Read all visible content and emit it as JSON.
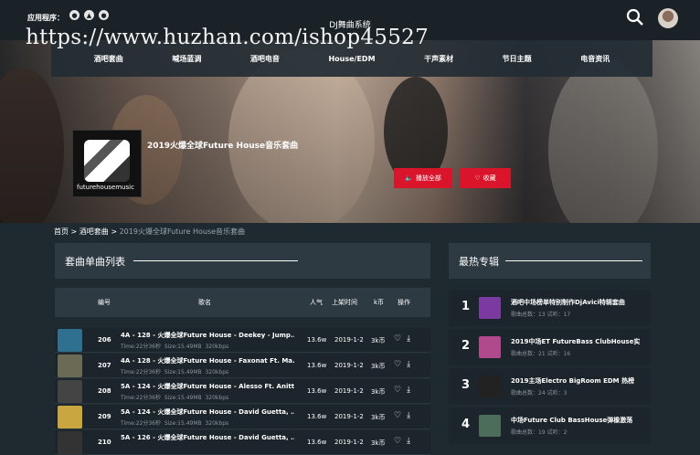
{
  "header": {
    "app_label": "应用程序：",
    "os_icons": [
      "apple-icon",
      "android-icon",
      "apple-icon"
    ],
    "site_title": "DJ舞曲系统",
    "watermark": "https://www.huzhan.com/ishop45527"
  },
  "nav": {
    "items": [
      {
        "label": "酒吧套曲"
      },
      {
        "label": "喊场蓝调"
      },
      {
        "label": "酒吧电音"
      },
      {
        "label": "House/EDM"
      },
      {
        "label": "干声素材"
      },
      {
        "label": "节日主题"
      },
      {
        "label": "电音资讯"
      }
    ]
  },
  "album": {
    "title": "2019火爆全球Future House音乐套曲",
    "cover_text": "futurehousemusic",
    "play_all": "播放全部",
    "favorite": "收藏"
  },
  "breadcrumb": {
    "home": "首页",
    "sep": ">",
    "section": "酒吧套曲",
    "current": "2019火爆全球Future House音乐套曲"
  },
  "tracklist": {
    "title": "套曲单曲列表",
    "columns": {
      "num": "编号",
      "name": "歌名",
      "popularity": "人气",
      "date": "上架时间",
      "price": "k币",
      "actions": "操作"
    },
    "rows": [
      {
        "num": "206",
        "name": "4A - 128 - 火爆全球Future House - Deekey - Jump...",
        "time": "Time:22分36秒",
        "size": "Size:15.49MB",
        "bitrate": "320kbps",
        "pop": "13.6w",
        "date": "2019-1-2",
        "price": "3k币",
        "thumb": "#2f6f8f"
      },
      {
        "num": "207",
        "name": "4A - 128 - 火爆全球Future House - Faxonat Ft. Ma...",
        "time": "Time:22分36秒",
        "size": "Size:15.49MB",
        "bitrate": "320kbps",
        "pop": "13.6w",
        "date": "2019-1-2",
        "price": "3k币",
        "thumb": "#6b6b55"
      },
      {
        "num": "208",
        "name": "5A - 124 - 火爆全球Future House - Alesso Ft. Anitt...",
        "time": "Time:22分36秒",
        "size": "Size:15.49MB",
        "bitrate": "320kbps",
        "pop": "13.6w",
        "date": "2019-1-2",
        "price": "3k币",
        "thumb": "#444444"
      },
      {
        "num": "209",
        "name": "5A - 124 - 火爆全球Future House - David Guetta, ...",
        "time": "Time:22分36秒",
        "size": "Size:15.49MB",
        "bitrate": "320kbps",
        "pop": "13.6w",
        "date": "2019-1-2",
        "price": "3k币",
        "thumb": "#c9a640"
      },
      {
        "num": "210",
        "name": "5A - 126 - 火爆全球Future House - David Guetta, ...",
        "time": "",
        "size": "",
        "bitrate": "",
        "pop": "13.6w",
        "date": "2019-1-2",
        "price": "3k币",
        "thumb": "#333333"
      }
    ]
  },
  "hot": {
    "title": "最热专辑",
    "items": [
      {
        "rank": "1",
        "title": "酒吧中场榜单特别制作DjAvici特辑套曲",
        "songs_label": "歌曲总数：",
        "songs": "13",
        "plays_label": "试听：",
        "plays": "17",
        "img": "#7a3aa0"
      },
      {
        "rank": "2",
        "title": "2019中场ET FutureBass ClubHouse实",
        "songs_label": "歌曲总数：",
        "songs": "21",
        "plays_label": "试听：",
        "plays": "16",
        "img": "#b04a8c"
      },
      {
        "rank": "3",
        "title": "2019主场Electro BigRoom EDM 热榜",
        "songs_label": "歌曲总数：",
        "songs": "24",
        "plays_label": "试听：",
        "plays": "3",
        "img": "#222222"
      },
      {
        "rank": "4",
        "title": "中场Future Club BassHouse弹橡激荡",
        "songs_label": "歌曲总数：",
        "songs": "19",
        "plays_label": "试听：",
        "plays": "2",
        "img": "#4d6d5a"
      }
    ]
  },
  "colors": {
    "accent": "#d9142b",
    "panel": "#2e3a42",
    "bg": "#1e2a30"
  }
}
